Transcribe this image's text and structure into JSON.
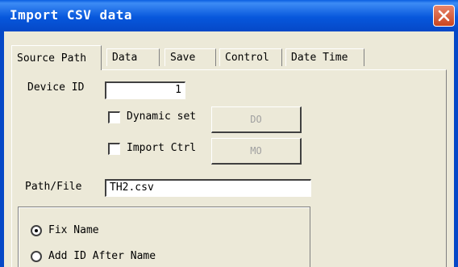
{
  "window": {
    "title": "Import CSV data"
  },
  "tabs": [
    {
      "label": "Source Path",
      "active": true
    },
    {
      "label": "Data",
      "active": false
    },
    {
      "label": "Save",
      "active": false
    },
    {
      "label": "Control",
      "active": false
    },
    {
      "label": "Date Time",
      "active": false
    }
  ],
  "source_path": {
    "device_id_label": "Device ID",
    "device_id_value": "1",
    "dynamic_set": {
      "label": "Dynamic set",
      "checked": false,
      "button_label": "DO"
    },
    "import_ctrl": {
      "label": "Import Ctrl",
      "checked": false,
      "button_label": "MO"
    },
    "path_file_label": "Path/File",
    "path_file_value": "TH2.csv",
    "name_options": [
      {
        "label": "Fix Name",
        "selected": true
      },
      {
        "label": "Add ID After Name",
        "selected": false
      }
    ]
  }
}
